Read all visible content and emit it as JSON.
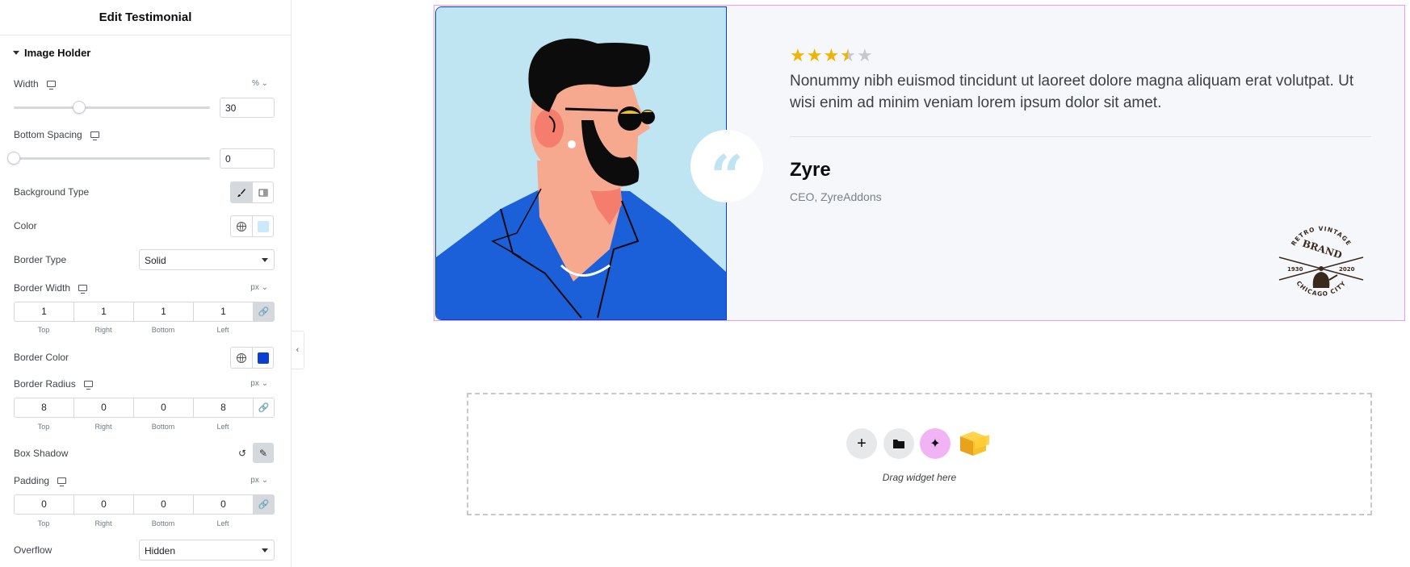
{
  "panel": {
    "title": "Edit Testimonial",
    "section": "Image Holder",
    "width": {
      "label": "Width",
      "unit": "% ⌄",
      "value": "30",
      "slider_fraction": 0.3
    },
    "bottom_spacing": {
      "label": "Bottom Spacing",
      "value": "0",
      "slider_fraction": 0
    },
    "background_type": {
      "label": "Background Type"
    },
    "color": {
      "label": "Color",
      "swatch": "#c8eafa"
    },
    "border_type": {
      "label": "Border Type",
      "value": "Solid"
    },
    "border_width": {
      "label": "Border Width",
      "unit": "px ⌄",
      "values": [
        "1",
        "1",
        "1",
        "1"
      ]
    },
    "border_color": {
      "label": "Border Color",
      "swatch": "#0a3fd6"
    },
    "border_radius": {
      "label": "Border Radius",
      "unit": "px ⌄",
      "values": [
        "8",
        "0",
        "0",
        "8"
      ]
    },
    "box_shadow": {
      "label": "Box Shadow"
    },
    "padding": {
      "label": "Padding",
      "unit": "px ⌄",
      "values": [
        "0",
        "0",
        "0",
        "0"
      ]
    },
    "dim_labels": [
      "Top",
      "Right",
      "Bottom",
      "Left"
    ],
    "overflow": {
      "label": "Overflow",
      "value": "Hidden"
    }
  },
  "testimonial": {
    "rating": 3.5,
    "rating_max": 5,
    "quote": "Nonummy nibh euismod tincidunt ut laoreet dolore magna aliquam erat volutpat. Ut wisi enim ad minim veniam lorem ipsum dolor sit amet.",
    "name": "Zyre",
    "role": "CEO, ZyreAddons",
    "logo": {
      "top_text": "RETRO VINTAGE",
      "brand": "BRAND",
      "year_left": "1930",
      "year_right": "2020",
      "bottom_text": "CHICAGO CITY"
    }
  },
  "dropzone": {
    "text": "Drag widget here"
  },
  "colors": {
    "image_bg": "#bfe4f2",
    "shirt": "#1b5fd9",
    "skin": "#f7a98f",
    "skin_shadow": "#f47d6e",
    "hair": "#0c0c0c",
    "star": "#f0b400",
    "ai_button": "#f0b4f5"
  }
}
